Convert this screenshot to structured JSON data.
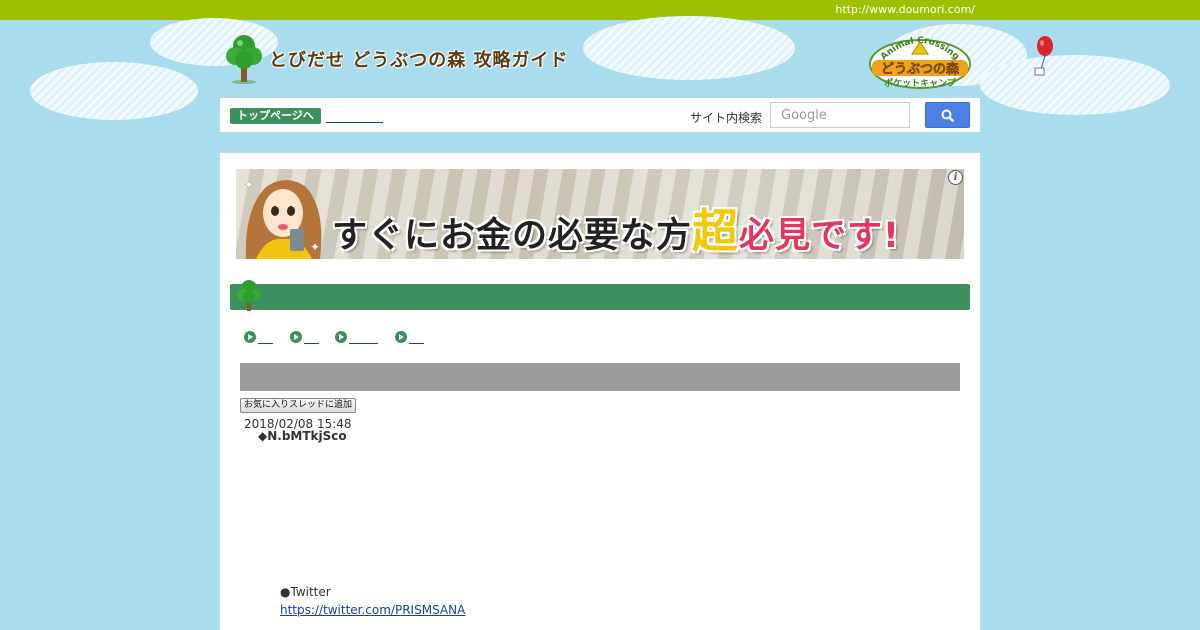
{
  "header": {
    "site_url": "http://www.doumori.com/",
    "site_title": "とびだせ どうぶつの森 攻略ガイド",
    "game_logo": {
      "arc_text": "Animal Crossing",
      "main_text": "どうぶつの森",
      "sub_text": "ポケットキャンプ"
    }
  },
  "nav": {
    "top_page_label": "トップページへ",
    "search_label": "サイト内検索",
    "search_placeholder": "Google"
  },
  "ad": {
    "text_main": "すぐにお金の必要な方",
    "text_highlight1": "超",
    "text_highlight2": "必見です!",
    "info_symbol": "i"
  },
  "post": {
    "favorite_button": "お気に入りスレッドに追加",
    "date": "2018/02/08 15:48",
    "author": "◆N.bMTkjSco",
    "twitter_label": "●Twitter",
    "twitter_url": "https://twitter.com/PRISMSANA"
  },
  "colors": {
    "top_bar": "#9dc100",
    "background": "#a9dced",
    "accent_green": "#3c8f5f",
    "search_button": "#4a7fe6",
    "link": "#1a3fa8"
  },
  "icons": [
    "tree-icon",
    "search-icon",
    "balloon-icon",
    "play-icon",
    "info-icon"
  ]
}
